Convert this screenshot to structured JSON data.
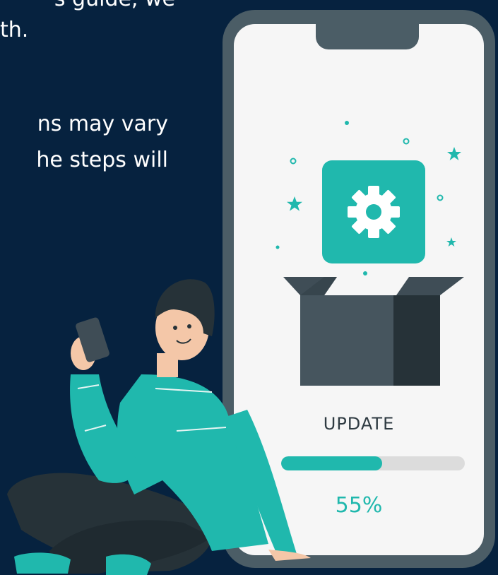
{
  "copy": {
    "line1": "s guide, we",
    "line2": "th.",
    "line3": "ns may vary",
    "line4": "he steps will"
  },
  "phone": {
    "update_label": "UPDATE",
    "progress_text": "55%",
    "progress_fraction": 0.55
  },
  "icons": {
    "app_icon": "gear-icon",
    "package": "open-box-icon",
    "decor": "sparkle-star-icon"
  },
  "colors": {
    "background": "#06223f",
    "accent": "#20b8ad",
    "phone_frame": "#4b5d66",
    "screen": "#f6f6f6",
    "track": "#dcdcdc"
  }
}
